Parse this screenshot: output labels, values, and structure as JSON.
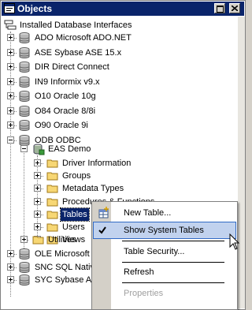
{
  "window": {
    "title": "Objects"
  },
  "tree": {
    "root": "Installed Database Interfaces",
    "interfaces": [
      "ADO Microsoft ADO.NET",
      "ASE Sybase ASE 15.x",
      "DIR Direct Connect",
      "IN9 Informix v9.x",
      "O10 Oracle 10g",
      "O84 Oracle 8/8i",
      "O90 Oracle 9i",
      "ODB ODBC"
    ],
    "profile": "EAS Demo",
    "folders": [
      "Driver Information",
      "Groups",
      "Metadata Types",
      "Procedures & Functions",
      "Tables",
      "Users",
      "Views"
    ],
    "utilities": "Utilities",
    "after": [
      "OLE Microsoft",
      "SNC SQL Nativ",
      "SYC Sybase AS"
    ]
  },
  "context_menu": {
    "items": [
      "New Table...",
      "Show System Tables",
      "Table Security...",
      "Refresh",
      "Properties"
    ],
    "checked_item": "Show System Tables",
    "disabled_item": "Properties"
  }
}
